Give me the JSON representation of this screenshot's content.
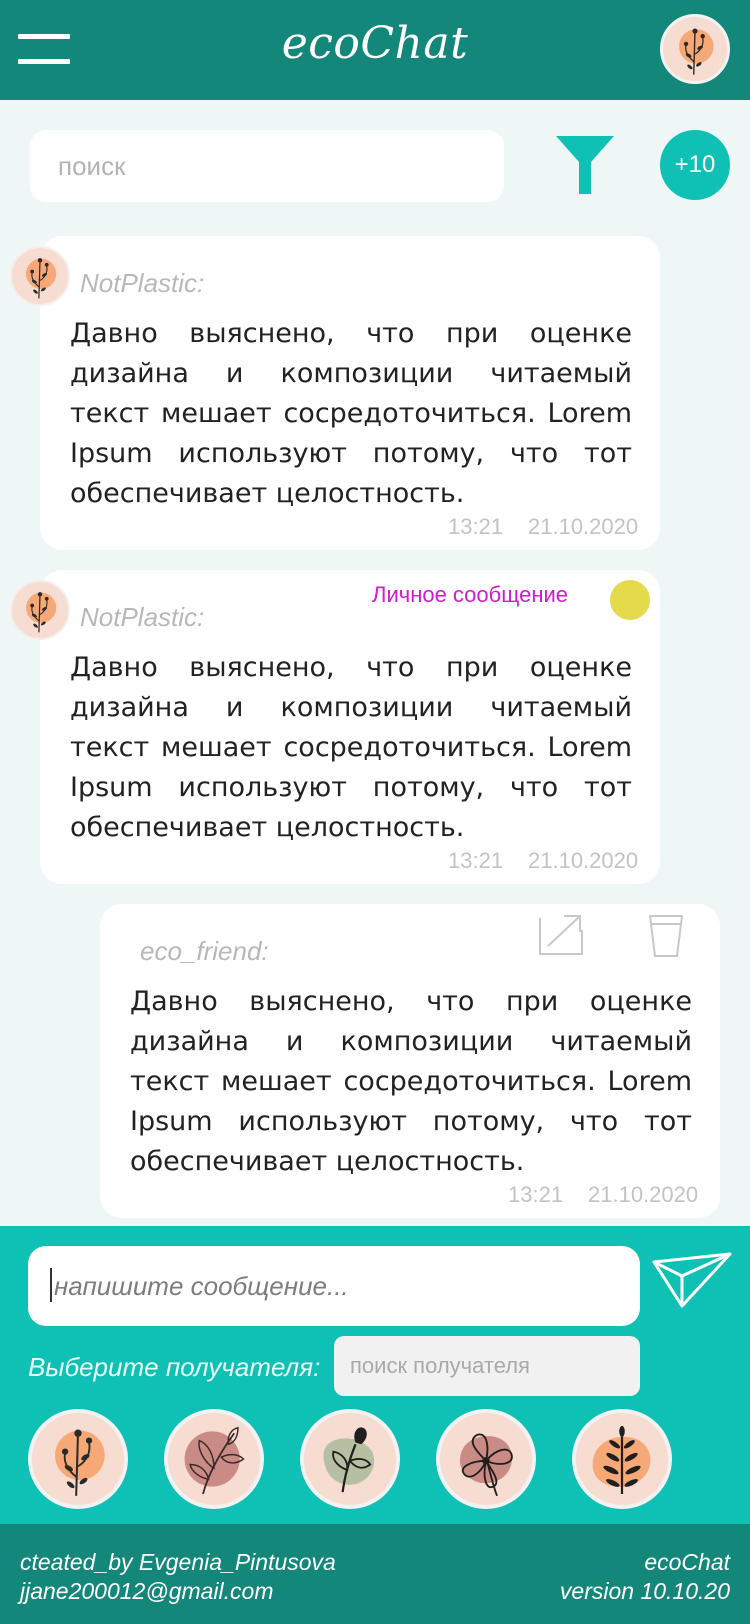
{
  "header": {
    "title": "ecoChat",
    "menu_icon": "hamburger-menu-icon",
    "profile_avatar": "user-avatar"
  },
  "search": {
    "placeholder": "поиск",
    "filter_icon": "filter-funnel-icon",
    "badge": "+10"
  },
  "messages": [
    {
      "author": "NotPlastic:",
      "text": "Давно выяснено, что при оценке дизайна и композиции читаемый текст мешает сосредоточиться. Lorem Ipsum используют потому, что тот обеспечивает целостность.",
      "time": "13:21",
      "date": "21.10.2020"
    },
    {
      "author": "NotPlastic:",
      "private_label": "Личное сообщение",
      "text": "Давно выяснено, что при оценке дизайна и композиции читаемый текст мешает сосредоточиться. Lorem Ipsum используют потому, что тот обеспечивает целостность.",
      "time": "13:21",
      "date": "21.10.2020"
    },
    {
      "author": "eco_friend:",
      "text": "Давно выяснено, что при оценке дизайна и композиции читаемый текст мешает сосредоточиться. Lorem Ipsum используют потому, что тот обеспечивает целостность.",
      "time": "13:21",
      "date": "21.10.2020",
      "actions": [
        "edit-icon",
        "delete-cup-icon"
      ]
    }
  ],
  "composer": {
    "placeholder": "напишите сообщение...",
    "send_icon": "send-paper-plane-icon",
    "recipient_label": "Выберите получателя:",
    "recipient_search_placeholder": "поиск получателя"
  },
  "footer": {
    "credit": "cteated_by Evgenia_Pintusova",
    "email": "jjane200012@gmail.com",
    "app_name": "ecoChat",
    "version": "version 10.10.20"
  },
  "colors": {
    "header": "#14877b",
    "accent": "#0fc1b5",
    "background": "#eef7f5",
    "private_label": "#d21ad0",
    "status_dot": "#e4da4b"
  }
}
